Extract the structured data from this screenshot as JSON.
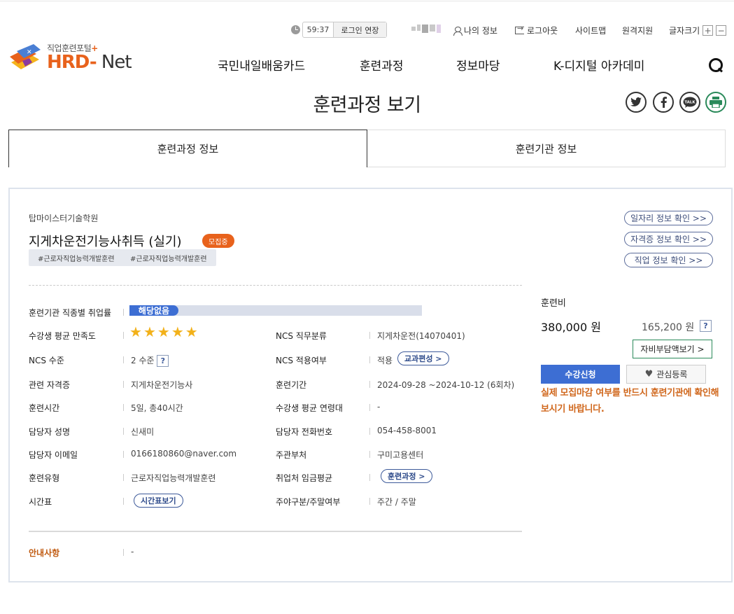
{
  "util": {
    "timer_value": "59:37",
    "extend_label": "로그인 연장",
    "my_info": "나의 정보",
    "logout": "로그아웃",
    "sitemap": "사이트맵",
    "remote": "원격지원",
    "font_size": "글자크기",
    "font_plus": "+",
    "font_minus": "−"
  },
  "logo": {
    "sub": "직업훈련포털",
    "sub_plus": "+",
    "hrd": "HRD",
    "dash": "-",
    "net": " Net"
  },
  "gnb": [
    "국민내일배움카드",
    "훈련과정",
    "정보마당",
    "K-디지털 아카데미"
  ],
  "page_title": "훈련과정 보기",
  "share": {
    "print": "▤",
    "talk": "TALK"
  },
  "tabs": [
    "훈련과정 정보",
    "훈련기관 정보"
  ],
  "course": {
    "institution": "탑마이스터기술학원",
    "title": "지게차운전기능사취득 (실기)",
    "badge": "모집중",
    "tags": [
      "#근로자직업능력개발훈련",
      "#근로자직업능력개발훈련"
    ]
  },
  "side_links": [
    "일자리 정보 확인 >>",
    "자격증 정보 확인 >>",
    "직업 정보 확인 >>"
  ],
  "info": {
    "emp_label": "훈련기관 직종별 취업률",
    "emp_value": "해당없음",
    "satisfaction_label": "수강생 평균 만족도",
    "satisfaction_stars": 5,
    "ncs_class_label": "NCS 직무분류",
    "ncs_class_value": "지게차운전(14070401)",
    "ncs_level_label": "NCS 수준",
    "ncs_level_value": "2 수준",
    "ncs_apply_label": "NCS 적용여부",
    "ncs_apply_value": "적용",
    "curriculum_btn": "교과편성 >",
    "cert_label": "관련 자격증",
    "cert_value": "지게차운전기능사",
    "period_label": "훈련기간",
    "period_value": "2024-09-28 ~2024-10-12 (6회차)",
    "hours_label": "훈련시간",
    "hours_value": "5일, 총40시간",
    "age_label": "수강생 평균 연령대",
    "age_value": "-",
    "manager_label": "담당자 성명",
    "manager_value": "신새미",
    "phone_label": "담당자 전화번호",
    "phone_value": "054-458-8001",
    "email_label": "담당자 이메일",
    "email_value": "0166180860@naver.com",
    "dept_label": "주관부처",
    "dept_value": "구미고용센터",
    "type_label": "훈련유형",
    "type_value": "근로자직업능력개발훈련",
    "wage_label": "취업처 임금평균",
    "wage_btn": "훈련과정 >",
    "schedule_label": "시간표",
    "schedule_btn": "시간표보기",
    "daynight_label": "주야구분/주말여부",
    "daynight_value": "주간 / 주말",
    "notice_label": "안내사항",
    "notice_value": "-",
    "q_mark": "?"
  },
  "fee": {
    "label": "훈련비",
    "main": "380,000 원",
    "self": "165,200 원",
    "selfpay_btn": "자비부담액보기 >",
    "apply_btn": "수강신청",
    "interest_btn": "관심등록",
    "warning": "실제 모집마감 여부를 반드시 훈련기관에 확인해보시기 바랍니다."
  },
  "colors": {
    "brand_orange": "#e8621c",
    "primary_blue": "#3d6ed3",
    "warning_orange": "#d0671c"
  }
}
